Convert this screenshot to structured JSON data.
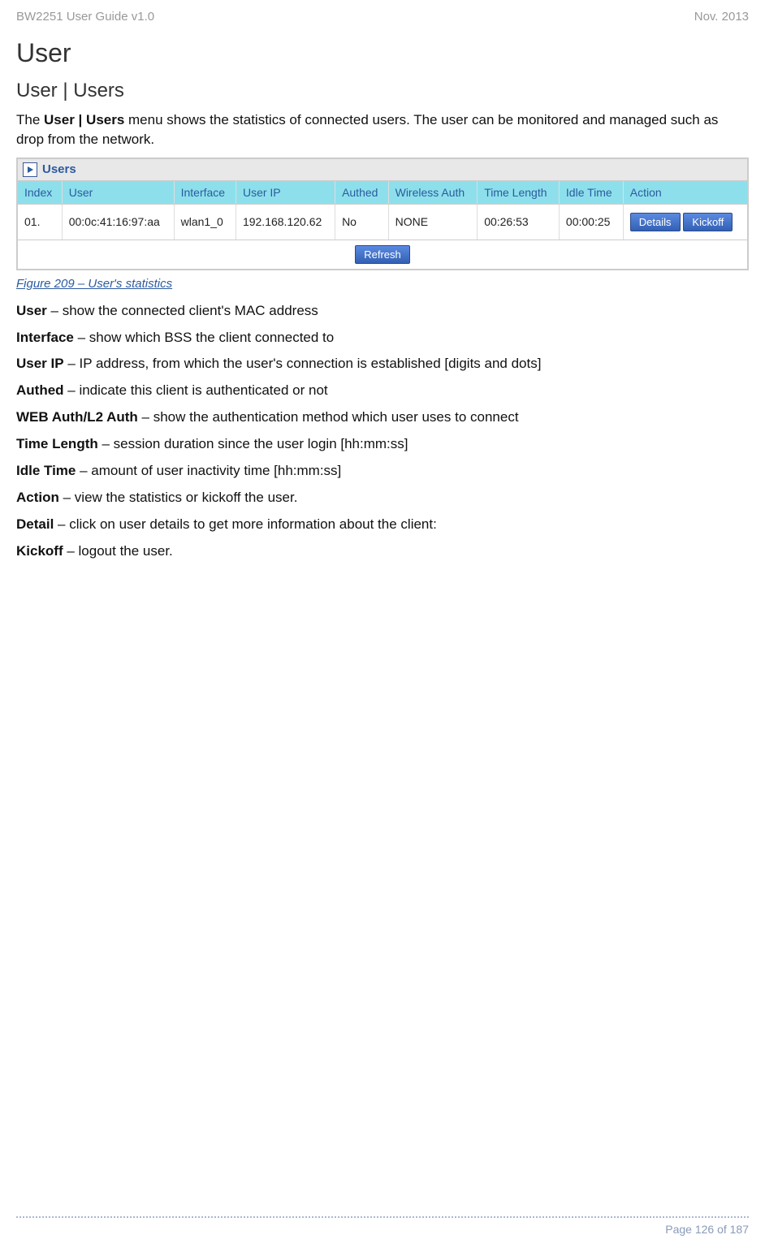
{
  "header": {
    "left": "BW2251 User Guide v1.0",
    "right": "Nov.  2013"
  },
  "headings": {
    "h1": "User",
    "h2": "User | Users"
  },
  "intro": {
    "prefix": "The ",
    "bold1": "User | Users",
    "rest": " menu shows the statistics of connected users. The user can be monitored and managed such as drop from the network."
  },
  "table": {
    "title": "Users",
    "columns": [
      "Index",
      "User",
      "Interface",
      "User IP",
      "Authed",
      "Wireless Auth",
      "Time Length",
      "Idle Time",
      "Action"
    ],
    "rows": [
      {
        "index": "01.",
        "user": "00:0c:41:16:97:aa",
        "iface": "wlan1_0",
        "ip": "192.168.120.62",
        "authed": "No",
        "wauth": "NONE",
        "tlen": "00:26:53",
        "idle": "00:00:25",
        "btn_details": "Details",
        "btn_kickoff": "Kickoff"
      }
    ],
    "refresh": "Refresh"
  },
  "figure_caption": "Figure 209 – User's statistics",
  "defs": [
    {
      "term": "User",
      "desc": " – show the connected client's MAC address"
    },
    {
      "term": "Interface",
      "desc": " – show which BSS the client connected to"
    },
    {
      "term": "User IP",
      "desc": " – IP address, from which the user's connection is established [digits and dots]"
    },
    {
      "term": "Authed",
      "desc": " – indicate this client is authenticated or not"
    },
    {
      "term": "WEB Auth/L2 Auth",
      "desc": " – show the authentication method which user uses to connect"
    },
    {
      "term": "Time Length",
      "desc": " – session duration since the user login [hh:mm:ss]"
    },
    {
      "term": "Idle Time",
      "desc": " – amount of user inactivity time [hh:mm:ss]"
    },
    {
      "term": "Action",
      "desc": " – view the statistics or kickoff the user."
    },
    {
      "term": "Detail",
      "desc": " – click on user details to get more information about the client:"
    },
    {
      "term": "Kickoff",
      "desc": " – logout the user."
    }
  ],
  "footer": {
    "page": "Page 126 of 187"
  }
}
